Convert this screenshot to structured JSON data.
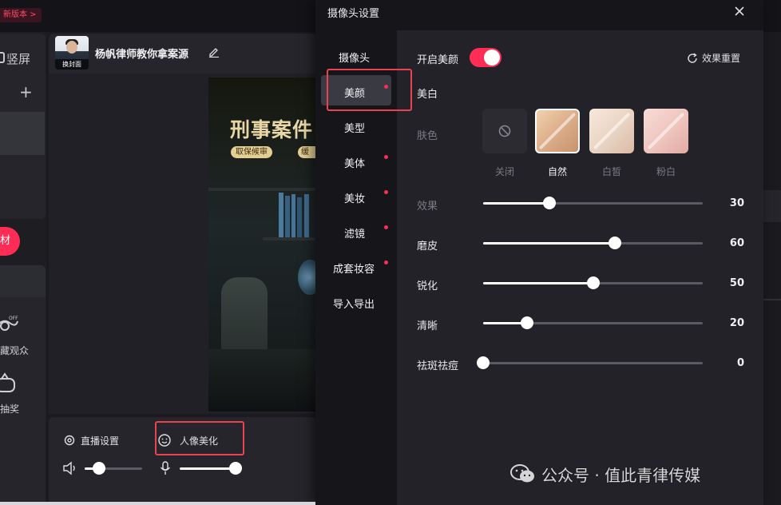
{
  "topbar": {
    "new_version": "新版本 >"
  },
  "left": {
    "portrait_label": "竖屏",
    "material_label": "材",
    "hide_audience_label": "藏观众",
    "lottery_label": "抽奖"
  },
  "stream": {
    "avatar_cover_label": "换封面",
    "streamer_name": "杨帆律师教你拿案源",
    "video_title": "刑事案件",
    "video_tag_1": "取保候审",
    "video_tag_2": "缓"
  },
  "toolbar": {
    "live_settings": "直播设置",
    "beauty": "人像美化",
    "speaker_volume": 0.25,
    "mic_volume": 1.0
  },
  "modal": {
    "title": "摄像头设置",
    "nav": [
      "摄像头",
      "美颜",
      "美型",
      "美体",
      "美妆",
      "滤镜",
      "成套妆容",
      "导入导出"
    ],
    "selected_nav": "美颜",
    "enable_label": "开启美颜",
    "enable_on": true,
    "reset_label": "效果重置",
    "whiten_title": "美白",
    "skin_label": "肤色",
    "skin_options": [
      "关闭",
      "自然",
      "白皙",
      "粉白"
    ],
    "selected_skin": "自然",
    "sliders": [
      {
        "label": "效果",
        "value": 30,
        "muted": true
      },
      {
        "label": "磨皮",
        "value": 60,
        "muted": false
      },
      {
        "label": "锐化",
        "value": 50,
        "muted": false
      },
      {
        "label": "清晰",
        "value": 20,
        "muted": false
      },
      {
        "label": "祛斑祛痘",
        "value": 0,
        "muted": false
      }
    ],
    "accent_color": "#ff2d55"
  },
  "watermark": {
    "text": "公众号 · 值此青律传媒"
  }
}
